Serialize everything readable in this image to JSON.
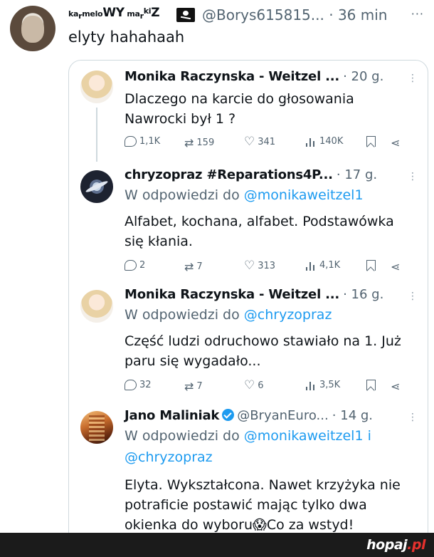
{
  "outer_tweet": {
    "display_name_parts": [
      "ka",
      "r",
      "melo",
      "WY",
      " ma",
      "r",
      "ki",
      "Z"
    ],
    "handle": "@Borys615815...",
    "separator": "·",
    "time": "36 min",
    "more": "···",
    "text": "elyty hahahaah"
  },
  "tweets": [
    {
      "name": "Monika Raczynska - Weitzel ...",
      "time": "· 20 g.",
      "body": [
        "Dlaczego na karcie do głosowania",
        "Nawrocki był 1 ?"
      ],
      "stats": {
        "replies": "1,1K",
        "retweets": "159",
        "likes": "341",
        "views": "140K"
      }
    },
    {
      "name": "chryzopraz #Reparations4P...",
      "time": "· 17 g.",
      "reply_prefix": "W odpowiedzi do ",
      "reply_to": "@monikaweitzel1",
      "body": [
        "Alfabet, kochana, alfabet. Podstawówka",
        "się kłania."
      ],
      "stats": {
        "replies": "2",
        "retweets": "7",
        "likes": "313",
        "views": "4,1K"
      }
    },
    {
      "name": "Monika Raczynska - Weitzel ...",
      "time": "· 16 g.",
      "reply_prefix": "W odpowiedzi do ",
      "reply_to": "@chryzopraz",
      "body": [
        "Część ludzi odruchowo stawiało na 1. Już",
        "paru się wygadało..."
      ],
      "stats": {
        "replies": "32",
        "retweets": "7",
        "likes": "6",
        "views": "3,5K"
      }
    },
    {
      "name": "Jano Maliniak",
      "handle": "@BryanEuro...",
      "time": "· 14 g.",
      "reply_prefix": "W odpowiedzi do ",
      "reply_to": "@monikaweitzel1",
      "reply_and": " i",
      "reply_to_2": "@chryzopraz",
      "body": [
        "Elyta. Wykształcona. Nawet krzyżyka nie",
        "potraficie postawić mając tylko dwa",
        "okienka do wyboru😱Co za wstyd!"
      ]
    }
  ],
  "icons": {
    "reply": "reply-icon",
    "retweet": "retweet-icon",
    "like": "like-icon",
    "views": "views-icon",
    "bookmark": "bookmark-icon",
    "share": "share-icon"
  },
  "footer": {
    "logo_main": "hopaj",
    "logo_tld": ".pl"
  },
  "colors": {
    "link": "#1d9bf0",
    "muted": "#536471",
    "footer_bg": "#1b1b1b",
    "logo_accent": "#e6312d"
  }
}
